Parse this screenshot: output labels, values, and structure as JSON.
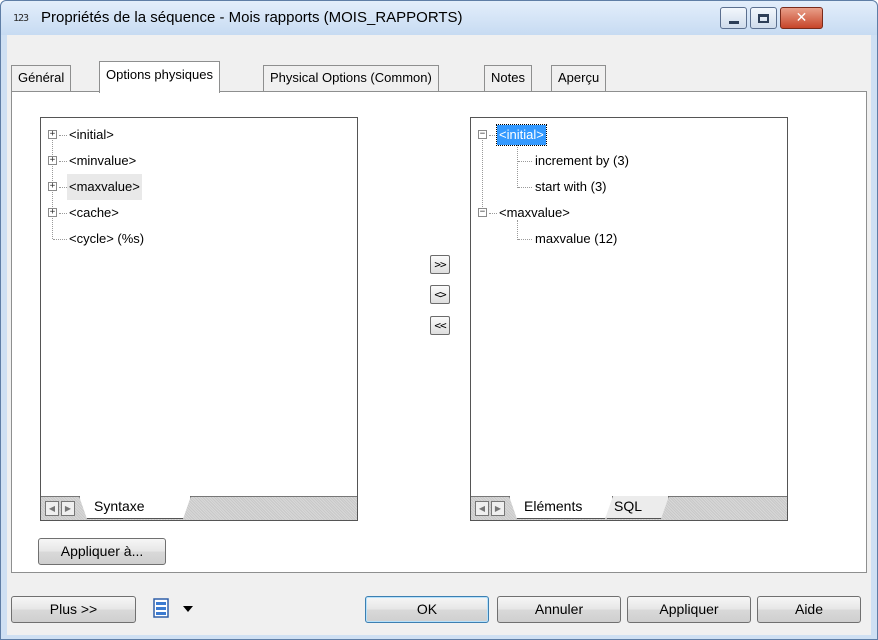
{
  "window": {
    "title": "Propriétés de la séquence - Mois rapports (MOIS_RAPPORTS)",
    "app_icon_text": "123",
    "close_glyph": "✕"
  },
  "tabs": [
    {
      "label": "Général",
      "active": false
    },
    {
      "label": "Options physiques",
      "active": true
    },
    {
      "label": "Physical Options (Common)",
      "active": false
    },
    {
      "label": "Notes",
      "active": false
    },
    {
      "label": "Aperçu",
      "active": false
    }
  ],
  "left_tree": {
    "items": [
      {
        "label": "<initial>",
        "expander": "+"
      },
      {
        "label": "<minvalue>",
        "expander": "+"
      },
      {
        "label": "<maxvalue>",
        "expander": "+",
        "highlighted": true
      },
      {
        "label": "<cache>",
        "expander": "+"
      },
      {
        "label": "<cycle> (%s)",
        "expander": null
      }
    ],
    "tabs": [
      {
        "label": "Syntaxe",
        "active": true
      }
    ]
  },
  "right_tree": {
    "items": [
      {
        "label": "<initial>",
        "expander": "−",
        "selected": true,
        "children": [
          {
            "label": "increment by (3)"
          },
          {
            "label": "start with (3)"
          }
        ]
      },
      {
        "label": "<maxvalue>",
        "expander": "−",
        "children": [
          {
            "label": "maxvalue (12)"
          }
        ]
      }
    ],
    "tabs": [
      {
        "label": "Eléments",
        "active": true
      },
      {
        "label": "SQL",
        "active": false
      }
    ]
  },
  "move_buttons": {
    "add": ">>",
    "replace": "<>",
    "remove": "<<"
  },
  "nav": {
    "prev": "◀",
    "next": "▶"
  },
  "apply_to_label": "Appliquer à...",
  "footer": {
    "more_label": "Plus >>",
    "ok_label": "OK",
    "cancel_label": "Annuler",
    "apply_label": "Appliquer",
    "help_label": "Aide"
  },
  "colors": {
    "selection": "#3399ff",
    "title_bg": "#cfe0f3",
    "close_button": "#c7452a"
  }
}
